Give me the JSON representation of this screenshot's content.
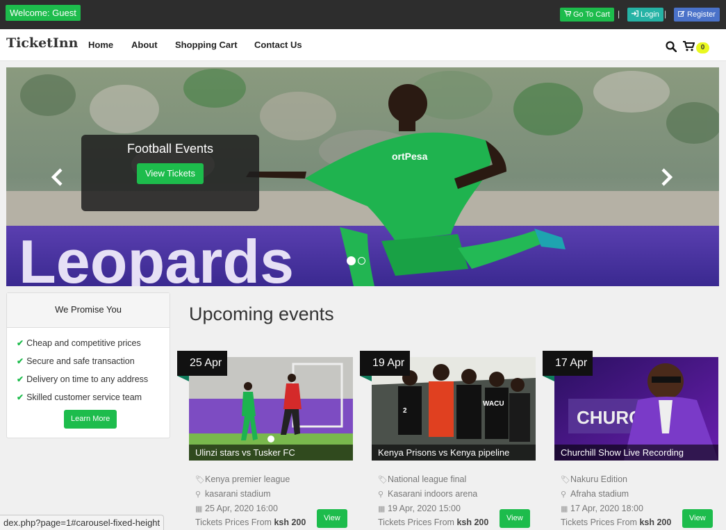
{
  "topbar": {
    "welcome": "Welcome: Guest",
    "go_to_cart": "Go To Cart",
    "login": "Login",
    "register": "Register",
    "separator": "|"
  },
  "nav": {
    "brand": "TicketInn",
    "items": [
      "Home",
      "About",
      "Shopping Cart",
      "Contact Us"
    ],
    "cart_count": "0"
  },
  "carousel": {
    "caption_title": "Football Events",
    "caption_button": "View Tickets",
    "prev": "‹",
    "next": "›",
    "slide_count": 2,
    "active_slide": 1,
    "banner_text": "Leopards",
    "shirt_text": "ortPesa"
  },
  "promise": {
    "heading": "We Promise You",
    "items": [
      "Cheap and competitive prices",
      "Secure and safe transaction",
      "Delivery on time to any address",
      "Skilled customer service team"
    ],
    "button": "Learn More"
  },
  "upcoming": {
    "title": "Upcoming events",
    "events": [
      {
        "date": "25 Apr",
        "name": "Ulinzi stars vs Tusker FC",
        "category": "Kenya premier league",
        "venue": "kasarani stadium",
        "datetime": "25 Apr, 2020 16:00",
        "price_prefix": "Tickets Prices From",
        "price": "ksh 200",
        "button": "View"
      },
      {
        "date": "19 Apr",
        "name": "Kenya Prisons vs Kenya pipeline",
        "category": "National league final",
        "venue": "Kasarani indoors arena",
        "datetime": "19 Apr, 2020 15:00",
        "price_prefix": "Tickets Prices From",
        "price": "ksh 200",
        "button": "View"
      },
      {
        "date": "17 Apr",
        "name": "Churchill Show Live Recording",
        "category": "Nakuru Edition",
        "venue": "Afraha stadium",
        "datetime": "17 Apr, 2020 18:00",
        "price_prefix": "Tickets Prices From",
        "price": "ksh 200",
        "button": "View"
      }
    ]
  },
  "status_bar": {
    "url": "dex.php?page=1#carousel-fixed-height"
  },
  "icons": {
    "cart": "shopping-cart-icon",
    "login": "sign-in-icon",
    "register": "edit-icon",
    "search": "search-icon",
    "check": "check-icon",
    "tag": "tag-icon",
    "location": "map-marker-icon",
    "calendar": "calendar-icon"
  },
  "colors": {
    "green": "#1dbc4c",
    "teal": "#26b3a5",
    "blue": "#4a72c9",
    "topbar": "#2d2d2d",
    "badge": "#e9f820"
  }
}
